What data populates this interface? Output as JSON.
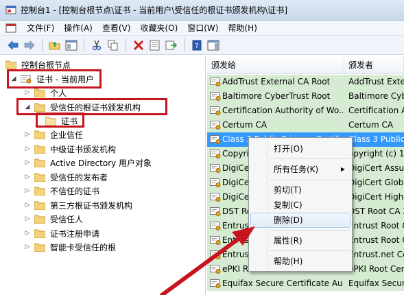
{
  "window": {
    "title": "控制台1 - [控制台根节点\\证书 - 当前用户\\受信任的根证书颁发机构\\证书]"
  },
  "menubar": {
    "items": [
      "文件(F)",
      "操作(A)",
      "查看(V)",
      "收藏夹(O)",
      "窗口(W)",
      "帮助(H)"
    ]
  },
  "tree": {
    "root": "控制台根节点",
    "store": "证书 - 当前用户",
    "personal": "个人",
    "trusted_root": "受信任的根证书颁发机构",
    "certs": "证书",
    "enterprise": "企业信任",
    "intermediate": "中级证书颁发机构",
    "ad_user": "Active Directory 用户对象",
    "publishers": "受信任的发布者",
    "untrusted": "不信任的证书",
    "third_party": "第三方根证书颁发机构",
    "people": "受信任人",
    "enrollment": "证书注册申请",
    "smartcard": "智能卡受信任的根"
  },
  "list": {
    "columns": {
      "issued_to": "颁发给",
      "issued_by": "颁发者"
    },
    "rows": [
      {
        "to": "AddTrust External CA Root",
        "by": "AddTrust Exte"
      },
      {
        "to": "Baltimore CyberTrust Root",
        "by": "Baltimore Cybe"
      },
      {
        "to": "Certification Authority of Wo...",
        "by": "Certification A"
      },
      {
        "to": "Certum CA",
        "by": "Certum CA"
      },
      {
        "to": "Class 3 Public Primary Certif...",
        "by": "Class 3 Public"
      },
      {
        "to": "Copyri",
        "by": "opyright (c) 1"
      },
      {
        "to": "DigiCe",
        "by": "DigiCert Assur"
      },
      {
        "to": "DigiCe",
        "by": "DigiCert Globa"
      },
      {
        "to": "DigiCe",
        "by": "DigiCert High"
      },
      {
        "to": "DST Ro",
        "by": "DST Root CA X"
      },
      {
        "to": "Entrust",
        "by": "Entrust Root C"
      },
      {
        "to": "Entrust",
        "by": "Entrust Root C"
      },
      {
        "to": "Entrust",
        "by": "Entrust.net Ce"
      },
      {
        "to": "ePKI Root Certification Authori...",
        "by": "ePKI Root Cert"
      },
      {
        "to": "Equifax Secure Certificate Au...",
        "by": "Equifax Secur"
      }
    ]
  },
  "context_menu": {
    "open": "打开(O)",
    "all_tasks": "所有任务(K)",
    "cut": "剪切(T)",
    "copy": "复制(C)",
    "delete": "删除(D)",
    "properties": "属性(R)",
    "help": "帮助(H)"
  },
  "colors": {
    "highlight": "#c8141e",
    "row_green": "#d6ecd2",
    "selection": "#3399ff"
  }
}
